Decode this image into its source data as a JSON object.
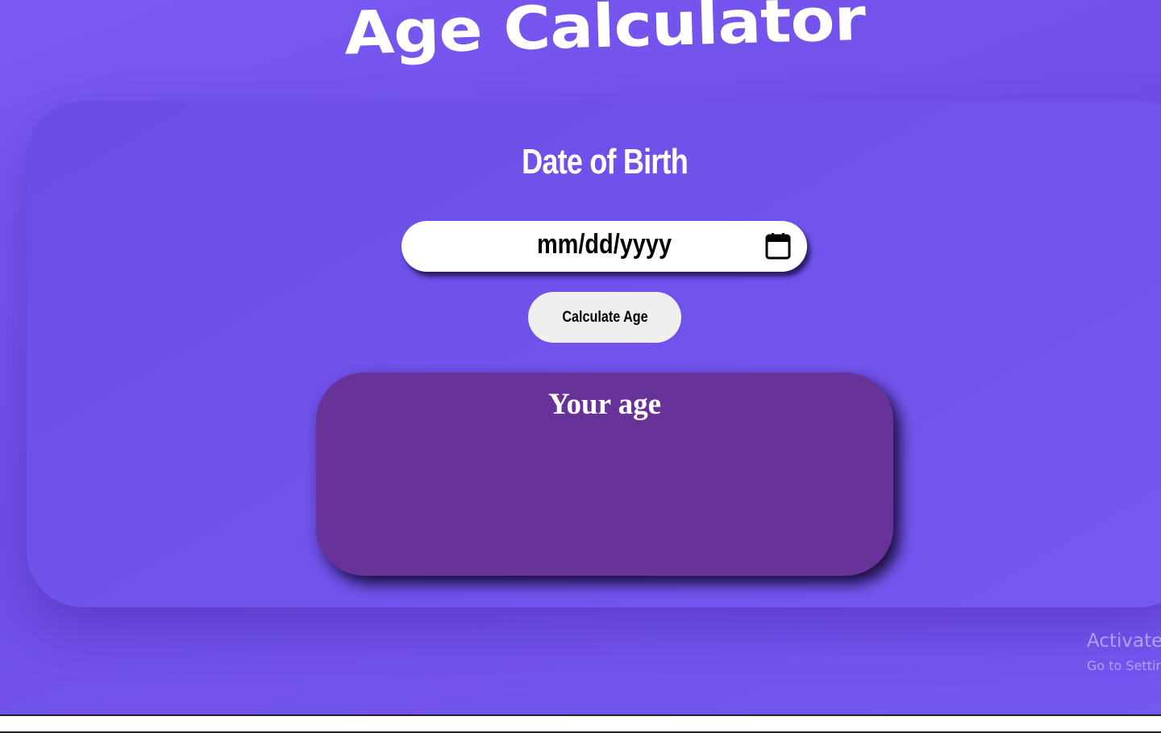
{
  "page": {
    "title": "Age Calculator"
  },
  "form": {
    "dob_label": "Date of Birth",
    "date_placeholder": "mm/dd/yyyy",
    "calculate_label": "Calculate Age"
  },
  "result": {
    "title": "Your age",
    "value": ""
  },
  "watermark": {
    "title": "Activate",
    "subtitle": "Go to Settir"
  },
  "icons": {
    "calendar": "calendar-icon"
  },
  "colors": {
    "background": "#7657f2",
    "card": "#7051ea",
    "result_box": "#673399",
    "button": "#efefef",
    "text_light": "#ffffff"
  }
}
